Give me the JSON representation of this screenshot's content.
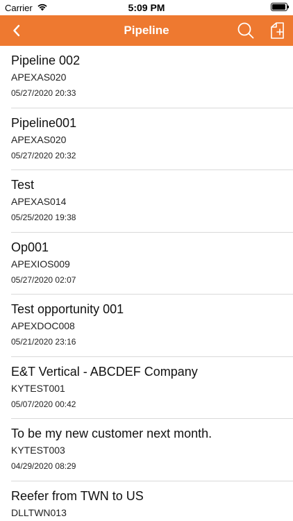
{
  "status_bar": {
    "carrier": "Carrier",
    "time": "5:09 PM",
    "battery_level": 0.95
  },
  "nav_bar": {
    "title": "Pipeline",
    "background_color": "#ee7930"
  },
  "icons": {
    "back": "chevron-left-icon",
    "search": "search-icon",
    "new": "new-document-icon"
  },
  "list": {
    "items": [
      {
        "title": "Pipeline 002",
        "code": "APEXAS020",
        "date": "05/27/2020 20:33"
      },
      {
        "title": "Pipeline001",
        "code": "APEXAS020",
        "date": "05/27/2020 20:32"
      },
      {
        "title": "Test",
        "code": "APEXAS014",
        "date": "05/25/2020 19:38"
      },
      {
        "title": "Op001",
        "code": "APEXIOS009",
        "date": "05/27/2020 02:07"
      },
      {
        "title": "Test opportunity 001",
        "code": "APEXDOC008",
        "date": "05/21/2020 23:16"
      },
      {
        "title": "E&T Vertical - ABCDEF Company",
        "code": "KYTEST001",
        "date": "05/07/2020 00:42"
      },
      {
        "title": "To be my new customer next month.",
        "code": "KYTEST003",
        "date": "04/29/2020 08:29"
      },
      {
        "title": "Reefer from TWN to US",
        "code": "DLLTWN013",
        "date": ""
      }
    ]
  }
}
